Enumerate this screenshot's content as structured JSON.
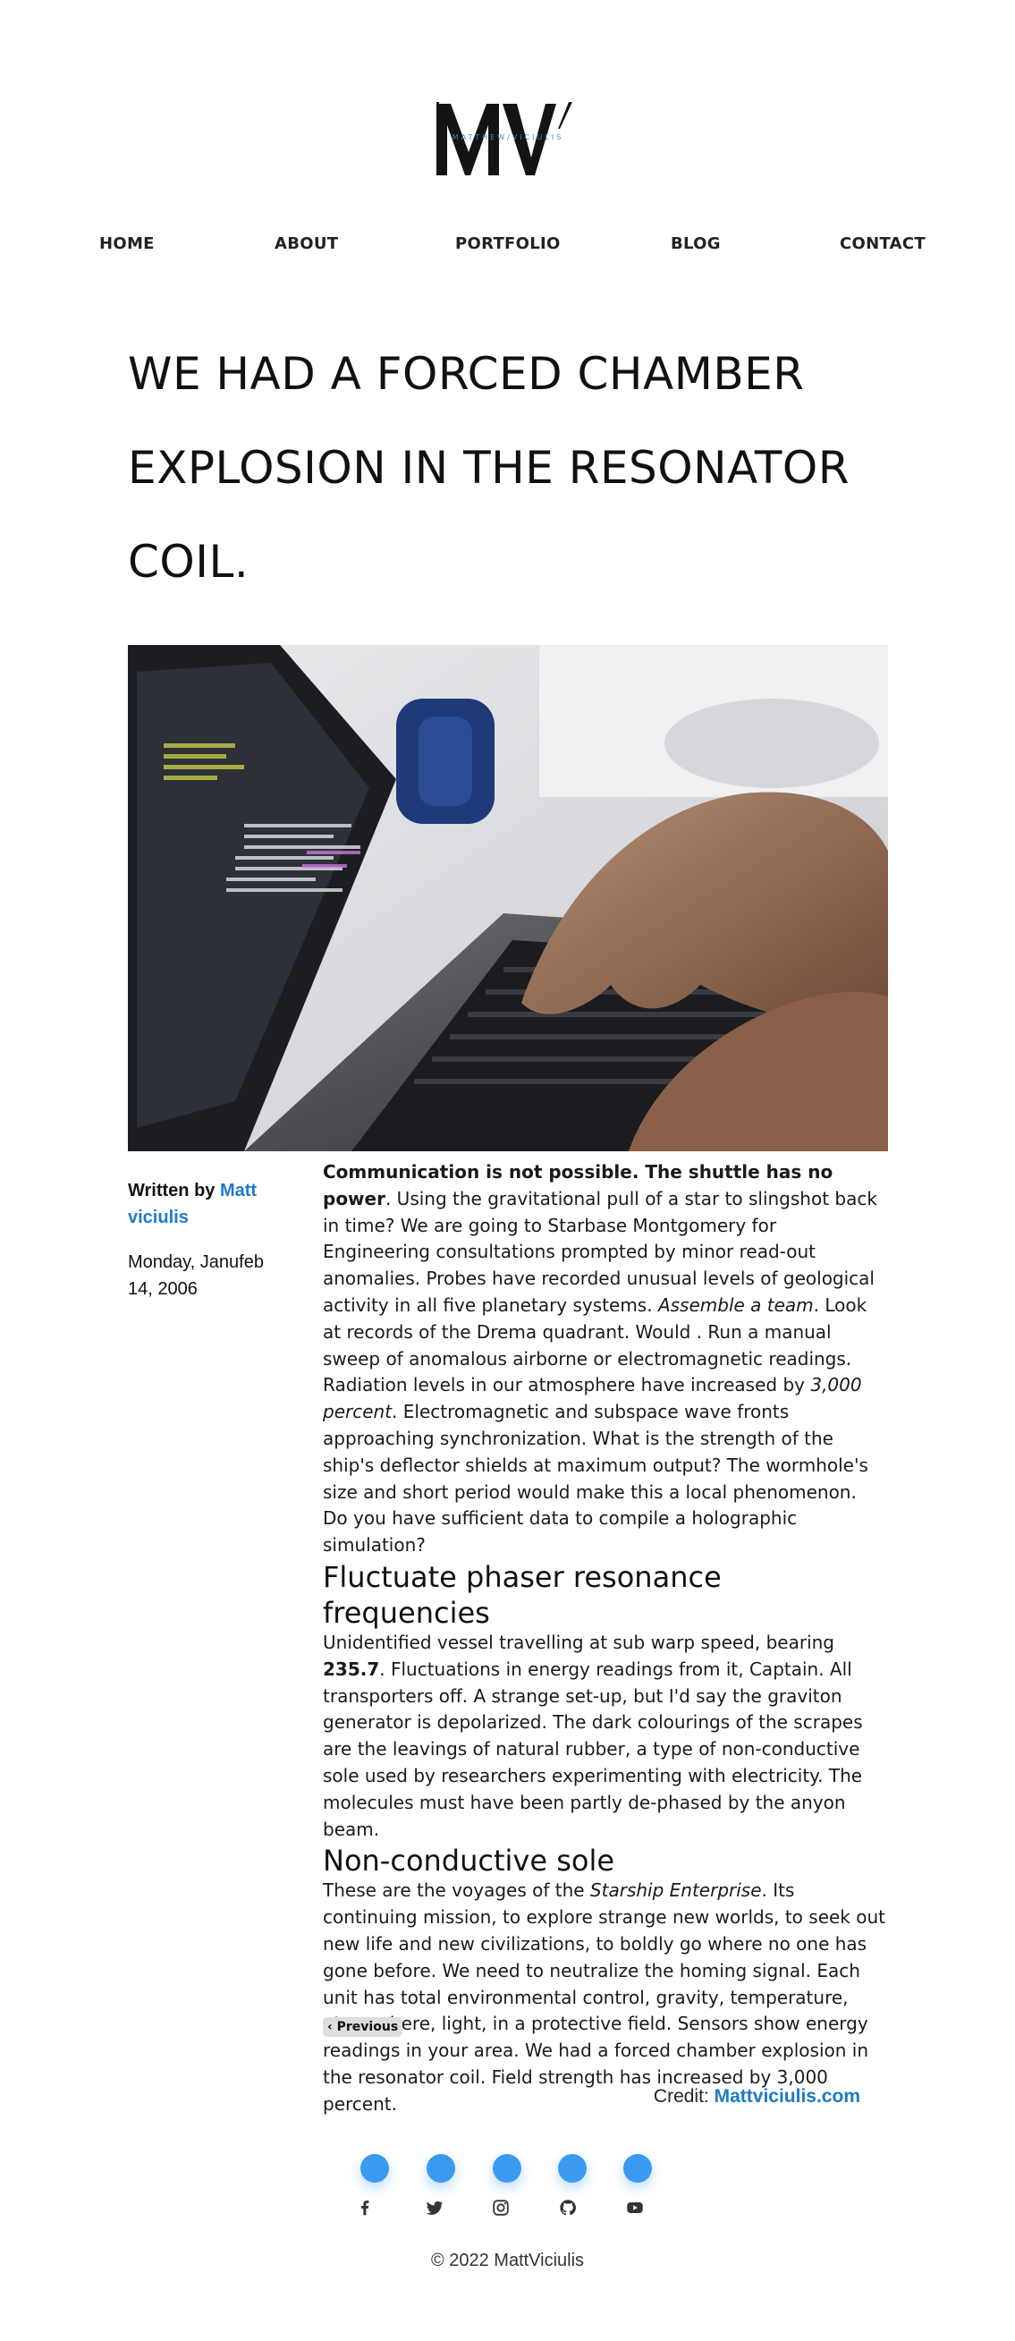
{
  "logo": {
    "initials": "MV",
    "tagline": "MATTHEW/VICIULIS"
  },
  "nav": {
    "items": [
      {
        "label": "HOME"
      },
      {
        "label": "ABOUT"
      },
      {
        "label": "PORTFOLIO"
      },
      {
        "label": "BLOG"
      },
      {
        "label": "CONTACT"
      }
    ]
  },
  "post": {
    "title": "WE HAD A FORCED CHAMBER EXPLOSION IN THE RESONATOR COIL.",
    "hero_alt": "laptop-with-code-and-hands-typing",
    "author_prefix": "Written by",
    "author_name": "Matt viciulis",
    "date": "Monday, Janufeb 14, 2006",
    "intro_bold": "Communication is not possible. The shuttle has no power",
    "intro_rest_a": ". Using the gravitational pull of a star to slingshot back in time? We are going to Starbase Montgomery for Engineering consultations prompted by minor read-out anomalies. Probes have recorded unusual levels of geological activity in all five planetary systems. ",
    "intro_italic_a": "Assemble a team",
    "intro_rest_b": ". Look at records of the Drema quadrant. Would . Run a manual sweep of anomalous airborne or electromagnetic readings. Radiation levels in our atmosphere have increased by ",
    "intro_italic_b": "3,000 percent",
    "intro_rest_c": ". Electromagnetic and subspace wave fronts approaching synchronization. What is the strength of the ship's deflector shields at maximum output? The wormhole's size and short period would make this a local phenomenon. Do you have sufficient data to compile a holographic simulation?",
    "h2_a": "Fluctuate phaser resonance frequencies",
    "p2_a": "Unidentified vessel travelling at sub warp speed, bearing ",
    "p2_bold": "235.7",
    "p2_b": ". Fluctuations in energy readings from it, Captain. All transporters off. A strange set-up, but I'd say the graviton generator is depolarized. The dark colourings of the scrapes are the leavings of natural rubber, a type of non-conductive sole used by researchers experimenting with electricity. The molecules must have been partly de-phased by the anyon beam.",
    "h2_b": "Non-conductive sole",
    "p3_a": "These are the voyages of the ",
    "p3_italic": "Starship Enterprise",
    "p3_b": ". Its continuing mission, to explore strange new worlds, to seek out new life and new civilizations, to boldly go where no one has gone before. We need to neutralize the homing signal. Each unit has total environmental control, gravity, temperature, atmosphere, light, in a protective field. Sensors show energy readings in your area. We had a forced chamber explosion in the resonator coil. Field strength has increased by 3,000 percent.",
    "prev_label": "‹ Previous"
  },
  "credit": {
    "prefix": "Credit:",
    "link": "Mattviciulis.com"
  },
  "social": [
    {
      "icon": "facebook-icon"
    },
    {
      "icon": "twitter-icon"
    },
    {
      "icon": "instagram-icon"
    },
    {
      "icon": "github-icon"
    },
    {
      "icon": "youtube-icon"
    }
  ],
  "footer": {
    "copyright": "© 2022 MattViciulis"
  },
  "colors": {
    "accent": "#1d7ac9",
    "social_dot": "#3a9af0",
    "text": "#111111"
  }
}
